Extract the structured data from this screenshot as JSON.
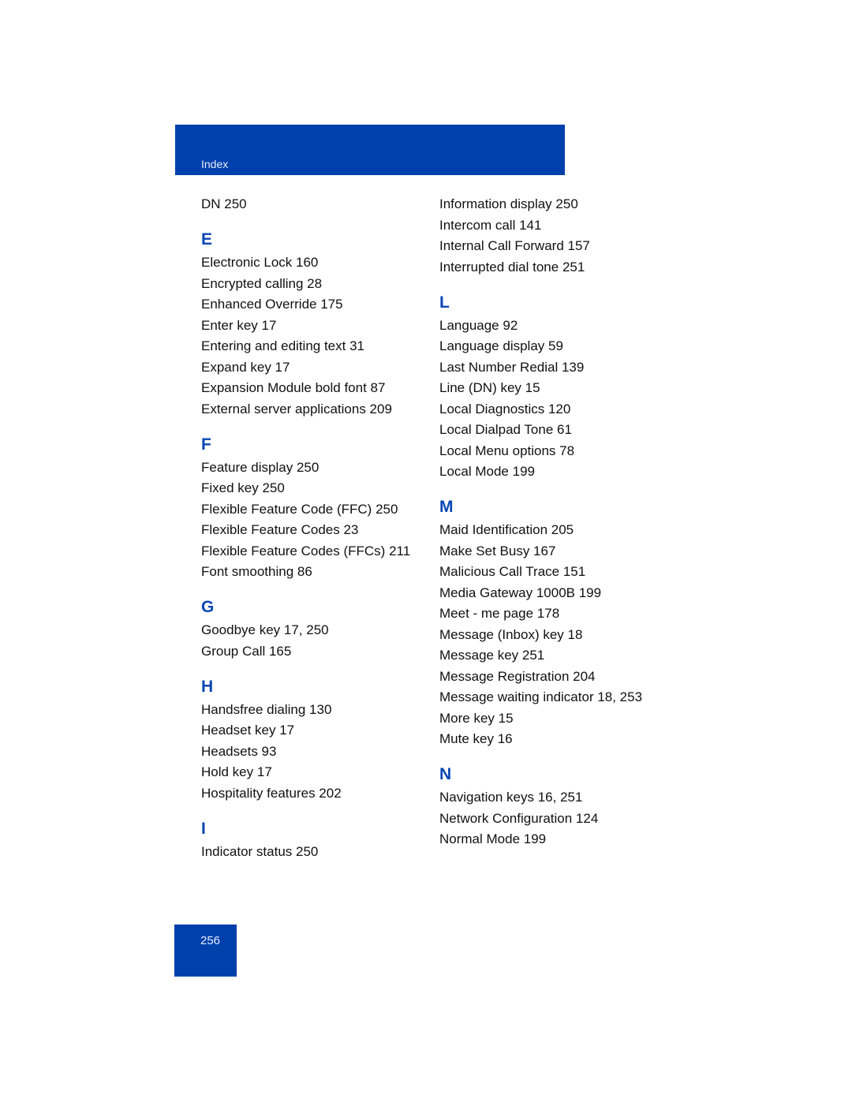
{
  "header": {
    "section_label": "Index"
  },
  "page_number": "256",
  "colors": {
    "brand_blue": "#0040ad",
    "letter_blue": "#0a46b4"
  },
  "left_column": {
    "leading_entries": [
      "DN 250"
    ],
    "groups": [
      {
        "letter": "E",
        "entries": [
          "Electronic Lock 160",
          "Encrypted calling 28",
          "Enhanced Override 175",
          "Enter key 17",
          "Entering and editing text 31",
          "Expand key 17",
          "Expansion Module bold font 87",
          "External server applications 209"
        ]
      },
      {
        "letter": "F",
        "entries": [
          "Feature display 250",
          "Fixed key 250",
          "Flexible Feature Code (FFC) 250",
          "Flexible Feature Codes 23",
          "Flexible Feature Codes (FFCs) 211",
          "Font smoothing 86"
        ]
      },
      {
        "letter": "G",
        "entries": [
          "Goodbye key 17, 250",
          "Group Call 165"
        ]
      },
      {
        "letter": "H",
        "entries": [
          "Handsfree dialing 130",
          "Headset key 17",
          "Headsets 93",
          "Hold key 17",
          "Hospitality features 202"
        ]
      },
      {
        "letter": "I",
        "entries": [
          "Indicator status 250"
        ]
      }
    ]
  },
  "right_column": {
    "leading_entries": [
      "Information display 250",
      "Intercom call 141",
      "Internal Call Forward 157",
      "Interrupted dial tone 251"
    ],
    "groups": [
      {
        "letter": "L",
        "entries": [
          "Language 92",
          "Language display 59",
          "Last Number Redial 139",
          "Line (DN) key 15",
          "Local Diagnostics 120",
          "Local Dialpad Tone 61",
          "Local Menu options 78",
          "Local Mode 199"
        ]
      },
      {
        "letter": "M",
        "entries": [
          "Maid Identification 205",
          "Make Set Busy 167",
          "Malicious Call Trace 151",
          "Media Gateway 1000B 199",
          "Meet - me page 178",
          "Message (Inbox) key 18",
          "Message key 251",
          "Message Registration 204",
          "Message waiting indicator 18, 253",
          "More key 15",
          "Mute key 16"
        ]
      },
      {
        "letter": "N",
        "entries": [
          "Navigation keys 16, 251",
          "Network Configuration 124",
          "Normal Mode 199"
        ]
      }
    ]
  }
}
